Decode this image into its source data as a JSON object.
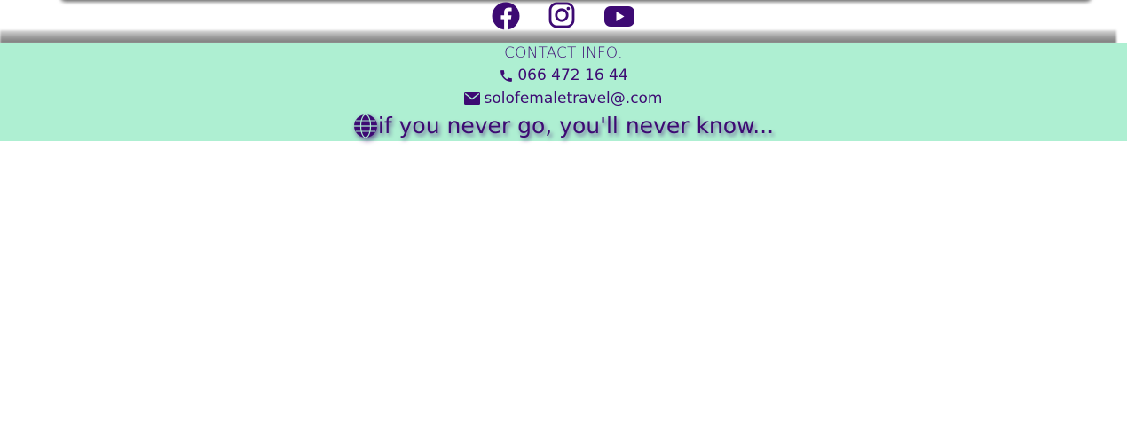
{
  "colors": {
    "brand_purple": "#3d0a73",
    "contact_band_bg": "#aeefd2",
    "page_bg": "#ffffff"
  },
  "social": {
    "items": [
      {
        "name": "facebook",
        "icon": "facebook-icon"
      },
      {
        "name": "instagram",
        "icon": "instagram-icon"
      },
      {
        "name": "youtube",
        "icon": "youtube-icon"
      }
    ]
  },
  "contact": {
    "title": "CONTACT INFO:",
    "phone": "066 472 16 44",
    "phone_icon": "phone-icon",
    "email": "solofemaletravel@.com",
    "email_icon": "envelope-icon",
    "motto": "if you never go, you'll never know...",
    "motto_icon": "globe-icon"
  }
}
